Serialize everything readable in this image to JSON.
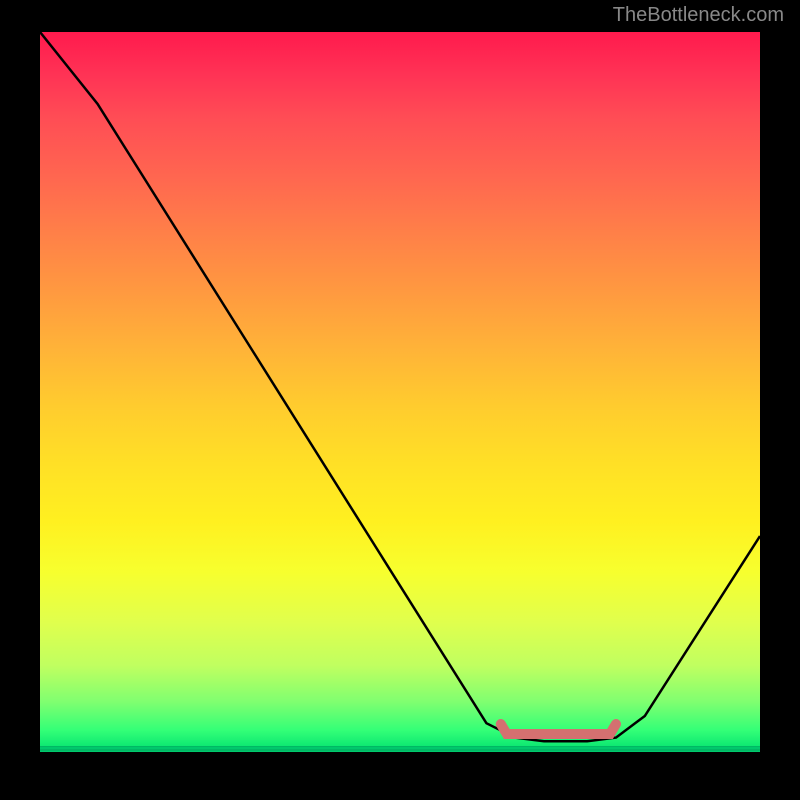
{
  "attribution": "TheBottleneck.com",
  "chart_data": {
    "type": "line",
    "title": "",
    "xlabel": "",
    "ylabel": "",
    "xlim": [
      0,
      100
    ],
    "ylim": [
      0,
      100
    ],
    "curve_points": [
      {
        "x": 0,
        "y": 100
      },
      {
        "x": 4,
        "y": 95
      },
      {
        "x": 8,
        "y": 90
      },
      {
        "x": 62,
        "y": 4
      },
      {
        "x": 66,
        "y": 2
      },
      {
        "x": 70,
        "y": 1.5
      },
      {
        "x": 76,
        "y": 1.5
      },
      {
        "x": 80,
        "y": 2
      },
      {
        "x": 84,
        "y": 5
      },
      {
        "x": 100,
        "y": 30
      }
    ],
    "optimal_range": {
      "start_x": 64,
      "end_x": 80,
      "y": 2.5
    },
    "gradient_stops": [
      {
        "pos": 0,
        "color": "#ff1a4d"
      },
      {
        "pos": 50,
        "color": "#ffcc2e"
      },
      {
        "pos": 100,
        "color": "#00e070"
      }
    ]
  }
}
